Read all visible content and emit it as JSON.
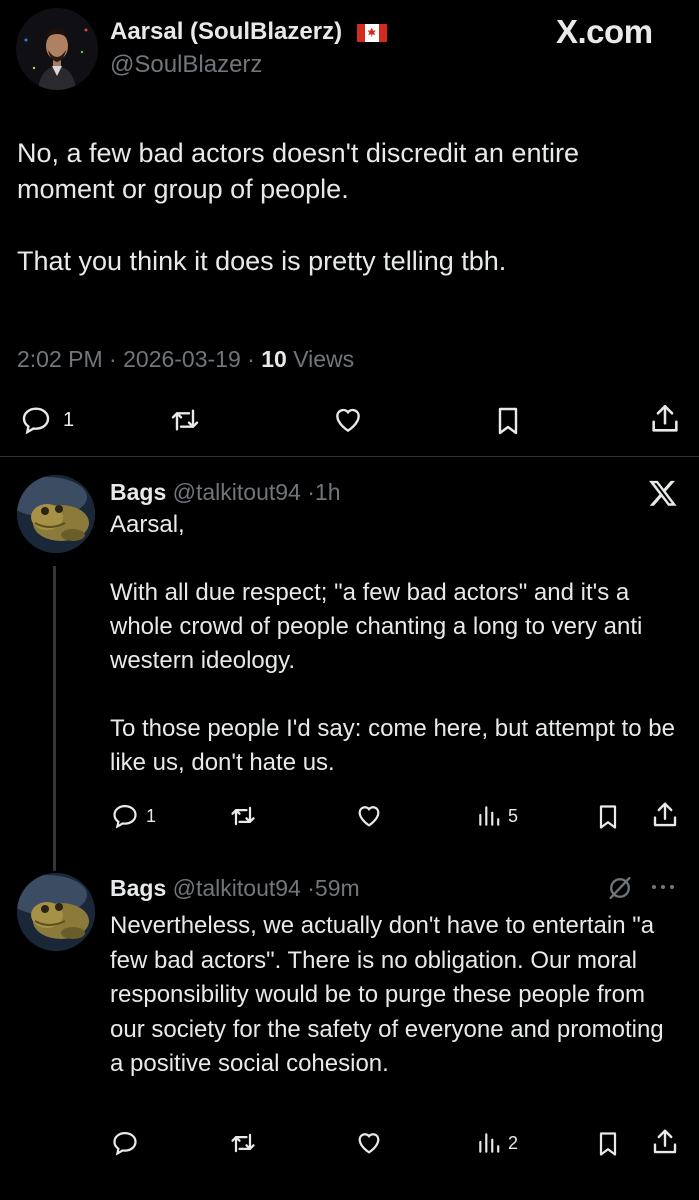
{
  "watermark": "X.com",
  "main_tweet": {
    "display_name": "Aarsal (SoulBlazerz)",
    "flag": "🇨🇦",
    "handle": "@SoulBlazerz",
    "paragraphs": [
      "No, a few bad actors doesn't discredit an entire moment or group of people.",
      "That you think it does is pretty telling tbh."
    ],
    "time": "2:02 PM",
    "date": "2026-03-19",
    "views_count": "10",
    "views_label": "Views",
    "replies": "1"
  },
  "reply1": {
    "display_name": "Bags",
    "handle": "@talkitout94",
    "age": "1h",
    "paragraphs": [
      "Aarsal,",
      "With all due respect; \"a few bad actors\" and it's a whole crowd of people chanting a long to very anti western ideology.",
      "To those people I'd say: come here, but attempt to be like us, don't hate us."
    ],
    "replies": "1",
    "views": "5"
  },
  "reply2": {
    "display_name": "Bags",
    "handle": "@talkitout94",
    "age": "59m",
    "paragraphs": [
      "Nevertheless, we actually don't have to entertain \"a few bad actors\". There is no obligation. Our moral responsibility would be to purge these people from our society for the safety of everyone and promoting a positive social cohesion."
    ],
    "views": "2"
  }
}
